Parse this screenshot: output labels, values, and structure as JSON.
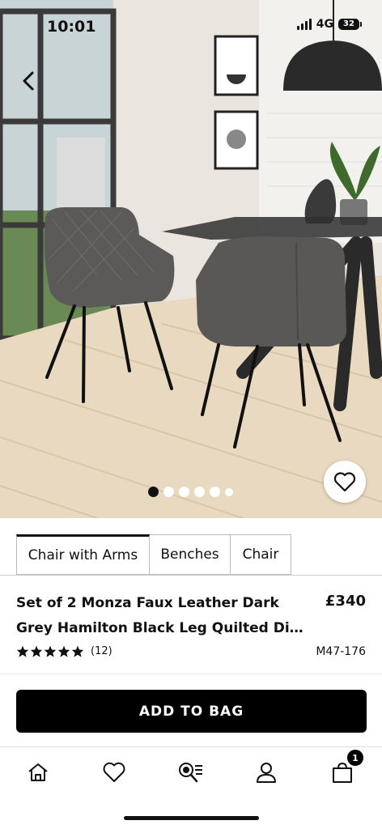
{
  "status_bar": {
    "time": "10:01",
    "network": "4G",
    "battery": "32"
  },
  "gallery": {
    "image_count": 6,
    "active_index": 0
  },
  "tabs": [
    {
      "label": "Chair with Arms",
      "active": true
    },
    {
      "label": "Benches",
      "active": false
    },
    {
      "label": "Chair",
      "active": false
    }
  ],
  "product": {
    "title_line1": "Set of 2 Monza Faux Leather Dark",
    "title_line2": "Grey Hamilton Black Leg Quilted Dini...",
    "price": "£340",
    "rating": 5,
    "review_count": "(12)",
    "sku": "M47-176"
  },
  "actions": {
    "add_to_bag": "ADD TO BAG"
  },
  "nav": {
    "items": [
      "home-icon",
      "heart-icon",
      "search-icon",
      "user-icon",
      "bag-icon"
    ],
    "bag_count": "1"
  },
  "colors": {
    "accent": "#000000",
    "background": "#ffffff"
  }
}
